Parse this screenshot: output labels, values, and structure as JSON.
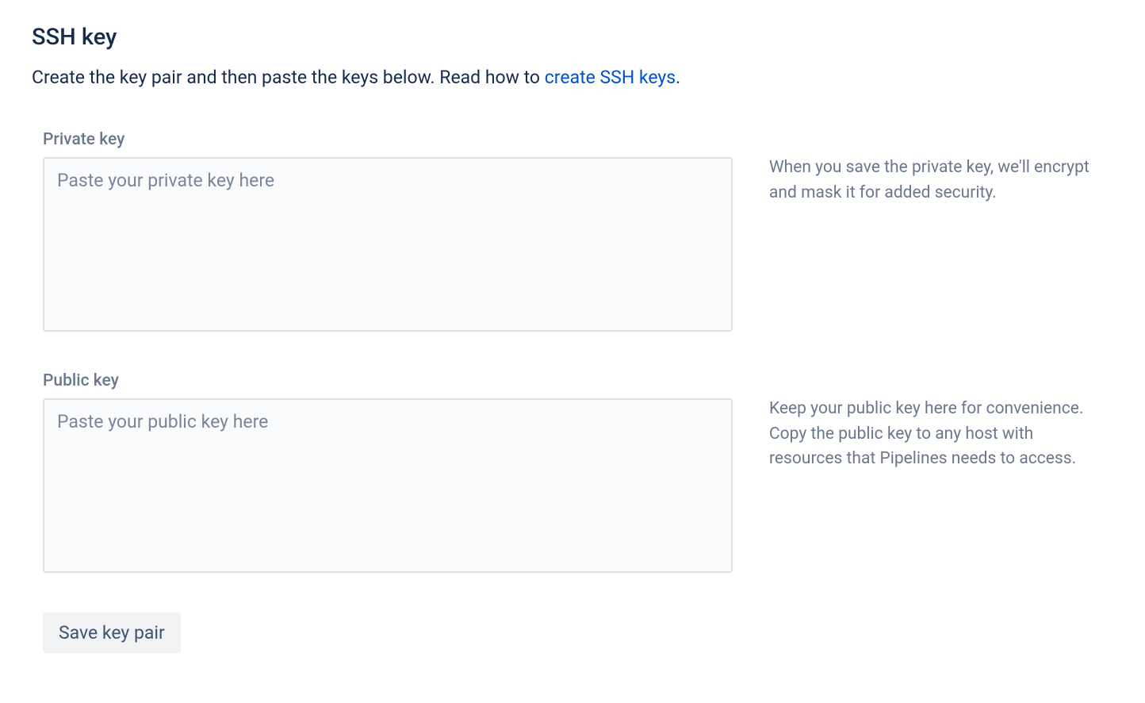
{
  "page": {
    "title": "SSH key",
    "description_prefix": "Create the key pair and then paste the keys below. Read how to ",
    "description_link": "create SSH keys",
    "description_suffix": "."
  },
  "private_key": {
    "label": "Private key",
    "placeholder": "Paste your private key here",
    "help": "When you save the private key, we'll encrypt and mask it for added security."
  },
  "public_key": {
    "label": "Public key",
    "placeholder": "Paste your public key here",
    "help": "Keep your public key here for convenience. Copy the public key to any host with resources that Pipelines needs to access."
  },
  "actions": {
    "save_label": "Save key pair"
  }
}
